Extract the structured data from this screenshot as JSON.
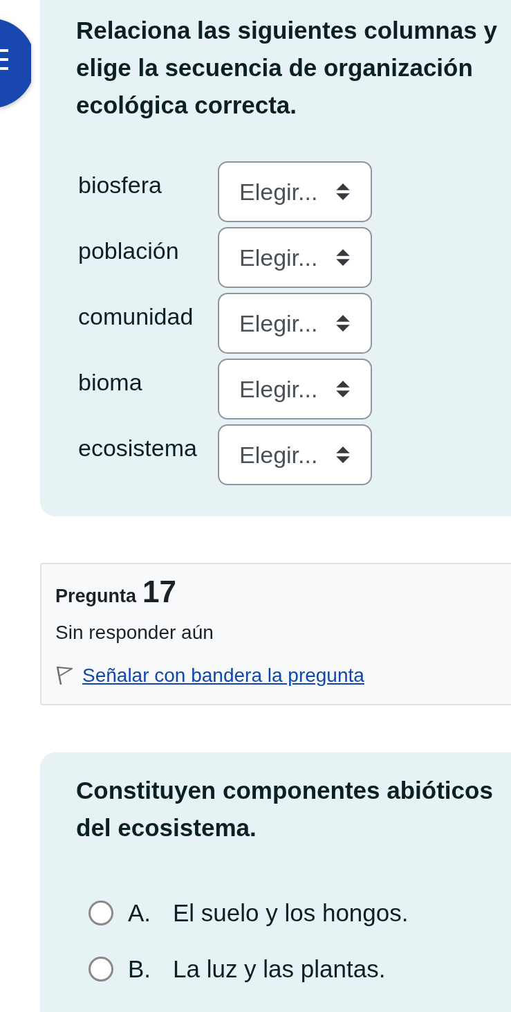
{
  "matching_question": {
    "prompt": "Relaciona las siguientes columnas y elige la secuencia de organización ecológica correcta.",
    "rows": [
      {
        "term": "biosfera",
        "choice": "Elegir..."
      },
      {
        "term": "población",
        "choice": "Elegir..."
      },
      {
        "term": "comunidad",
        "choice": "Elegir..."
      },
      {
        "term": "bioma",
        "choice": "Elegir..."
      },
      {
        "term": "ecosistema",
        "choice": "Elegir..."
      }
    ]
  },
  "question_info": {
    "label": "Pregunta",
    "number": "17",
    "status": "Sin responder aún",
    "flag_link": "Señalar con bandera la pregunta",
    "flagged": false
  },
  "multiple_choice": {
    "prompt": "Constituyen componentes abióticos del ecosistema.",
    "options": [
      {
        "letter": "A.",
        "text": "El suelo y los hongos.",
        "selected": false
      },
      {
        "letter": "B.",
        "text": "La luz y las plantas.",
        "selected": false
      }
    ]
  }
}
